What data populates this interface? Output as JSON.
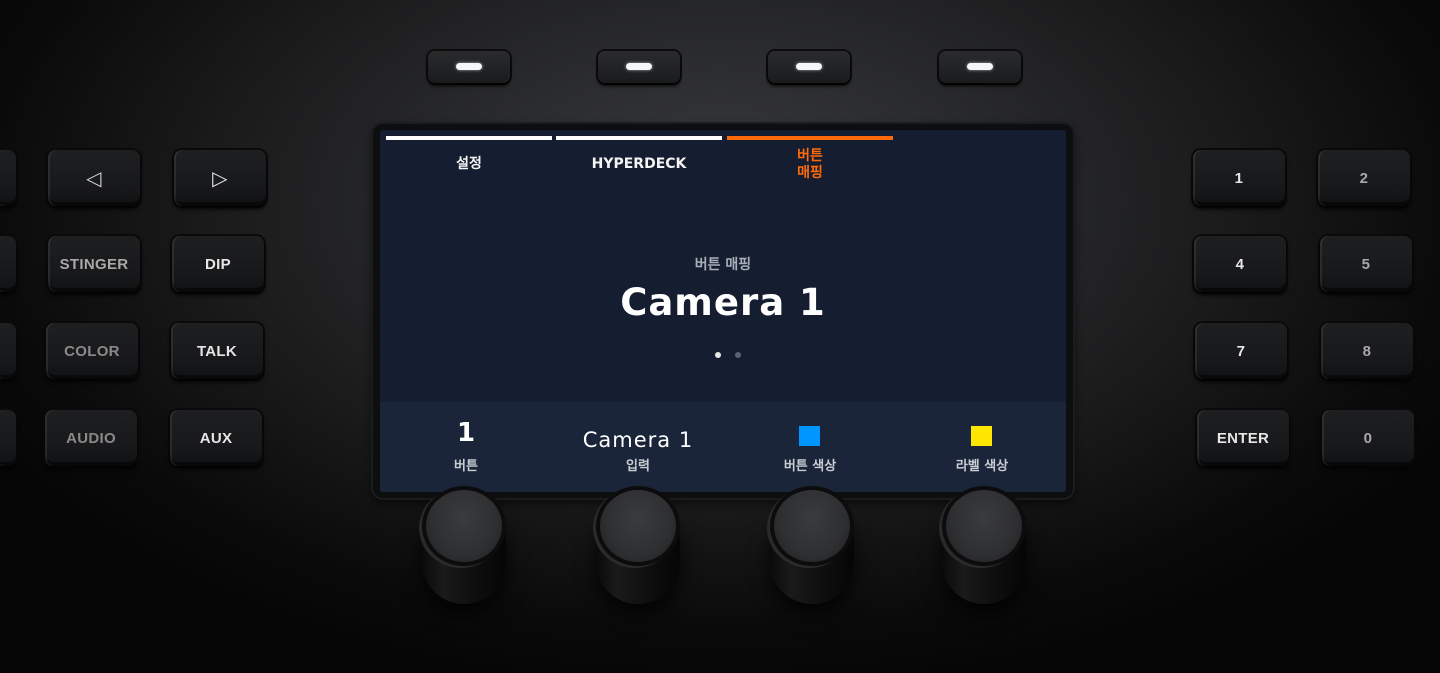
{
  "softkeys": [
    {
      "name": "softkey-1"
    },
    {
      "name": "softkey-2"
    },
    {
      "name": "softkey-3"
    },
    {
      "name": "softkey-4"
    }
  ],
  "left_keys": [
    {
      "label": "◁",
      "icon": "triangle-left-icon"
    },
    {
      "label": "▷",
      "icon": "triangle-right-icon"
    },
    {
      "label": "STINGER"
    },
    {
      "label": "DIP"
    },
    {
      "label": "COLOR"
    },
    {
      "label": "TALK"
    },
    {
      "label": "AUDIO"
    },
    {
      "label": "AUX"
    }
  ],
  "right_keys": [
    {
      "label": "1"
    },
    {
      "label": "2"
    },
    {
      "label": "4"
    },
    {
      "label": "5"
    },
    {
      "label": "7"
    },
    {
      "label": "8"
    },
    {
      "label": "ENTER"
    },
    {
      "label": "0"
    }
  ],
  "screen": {
    "tabs": [
      {
        "label": "설정",
        "active": false
      },
      {
        "label": "HYPERDECK",
        "active": false
      },
      {
        "label": "버튼\n매핑",
        "label_line1": "버튼",
        "label_line2": "매핑",
        "active": true
      }
    ],
    "subtitle": "버튼 매핑",
    "title": "Camera 1",
    "page_indicator": {
      "current": 1,
      "total": 2
    },
    "footer": [
      {
        "value": "1",
        "label": "버튼"
      },
      {
        "value": "Camera 1",
        "label": "입력"
      },
      {
        "swatch_color": "#0096ff",
        "label": "버튼 색상"
      },
      {
        "swatch_color": "#ffe600",
        "label": "라벨 색상"
      }
    ]
  },
  "colors": {
    "active_tab": "#ff6b0a",
    "screen_bg": "#141e30",
    "footer_bg": "#1b2539"
  }
}
